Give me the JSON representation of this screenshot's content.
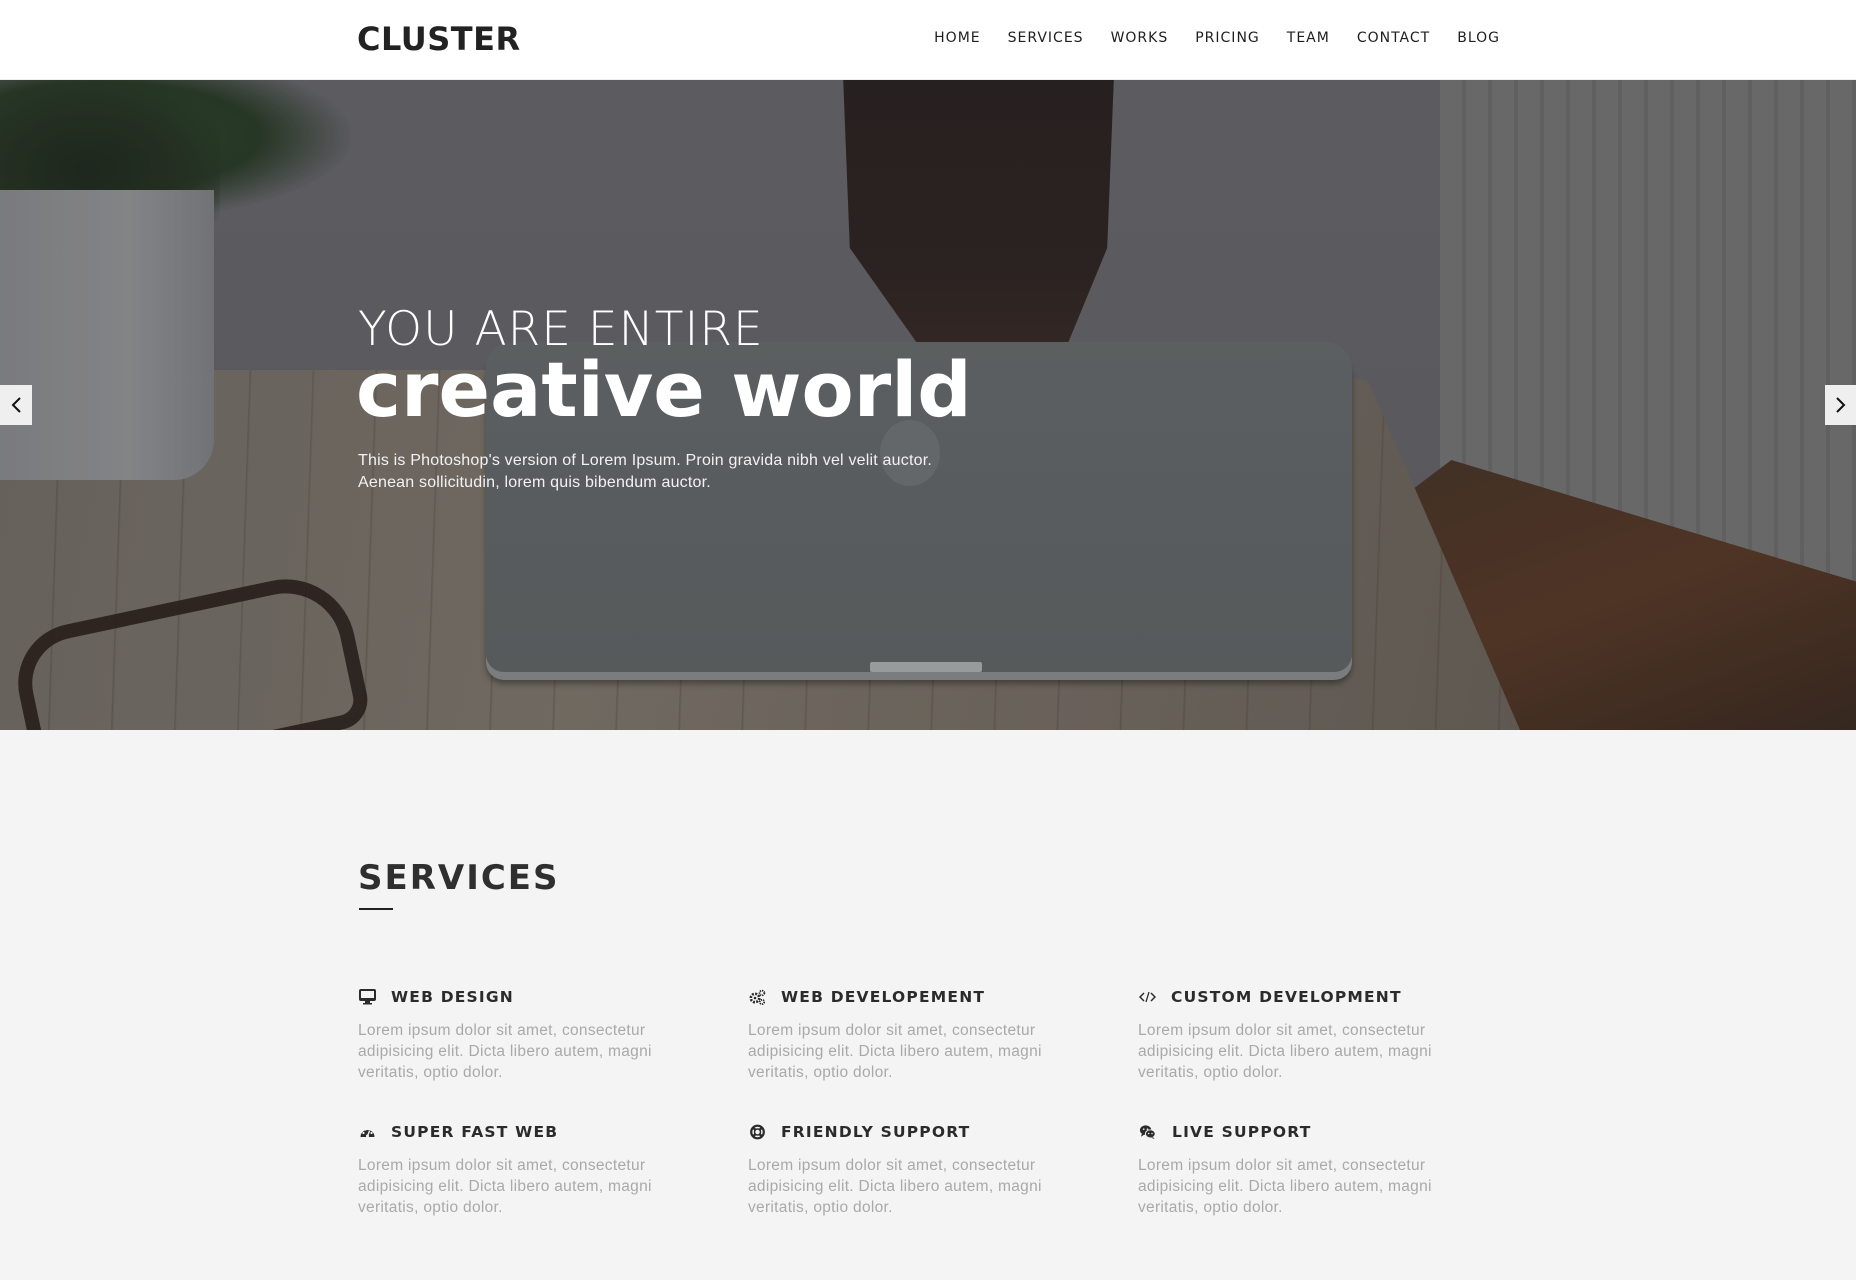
{
  "header": {
    "logo": "CLUSTER",
    "nav": [
      {
        "label": "HOME"
      },
      {
        "label": "SERVICES"
      },
      {
        "label": "WORKS"
      },
      {
        "label": "PRICING"
      },
      {
        "label": "TEAM"
      },
      {
        "label": "CONTACT"
      },
      {
        "label": "BLOG"
      }
    ]
  },
  "hero": {
    "line1": "YOU ARE ENTIRE",
    "line2": "creative world",
    "paragraph": [
      "This is Photoshop's version of Lorem Ipsum. Proin gravida nibh vel velit auctor.",
      "Aenean sollicitudin, lorem quis bibendum auctor."
    ],
    "prev_icon": "chevron-left-icon",
    "next_icon": "chevron-right-icon"
  },
  "services": {
    "title": "SERVICES",
    "items": [
      {
        "icon": "desktop-icon",
        "title": "WEB DESIGN",
        "desc": [
          "Lorem ipsum dolor sit amet, consectetur",
          "adipisicing elit. Dicta libero autem, magni",
          "veritatis, optio dolor."
        ]
      },
      {
        "icon": "cogs-icon",
        "title": "WEB DEVELOPEMENT",
        "desc": [
          "Lorem ipsum dolor sit amet, consectetur",
          "adipisicing elit. Dicta libero autem, magni",
          "veritatis, optio dolor."
        ]
      },
      {
        "icon": "code-icon",
        "title": "CUSTOM DEVELOPMENT",
        "desc": [
          "Lorem ipsum dolor sit amet, consectetur",
          "adipisicing elit. Dicta libero autem, magni",
          "veritatis, optio dolor."
        ]
      },
      {
        "icon": "dashboard-icon",
        "title": "SUPER FAST WEB",
        "desc": [
          "Lorem ipsum dolor sit amet, consectetur",
          "adipisicing elit. Dicta libero autem, magni",
          "veritatis, optio dolor."
        ]
      },
      {
        "icon": "life-ring-icon",
        "title": "FRIENDLY SUPPORT",
        "desc": [
          "Lorem ipsum dolor sit amet, consectetur",
          "adipisicing elit. Dicta libero autem, magni",
          "veritatis, optio dolor."
        ]
      },
      {
        "icon": "chat-icon",
        "title": "LIVE SUPPORT",
        "desc": [
          "Lorem ipsum dolor sit amet, consectetur",
          "adipisicing elit. Dicta libero autem, magni",
          "veritatis, optio dolor."
        ]
      }
    ]
  },
  "colors": {
    "header_bg": "#ffffff",
    "text_dark": "#2b2b2b",
    "text_muted": "#a9a9a9",
    "section_bg": "#f4f4f4",
    "hero_text": "#ffffff",
    "arrow_bg": "#efefef"
  }
}
